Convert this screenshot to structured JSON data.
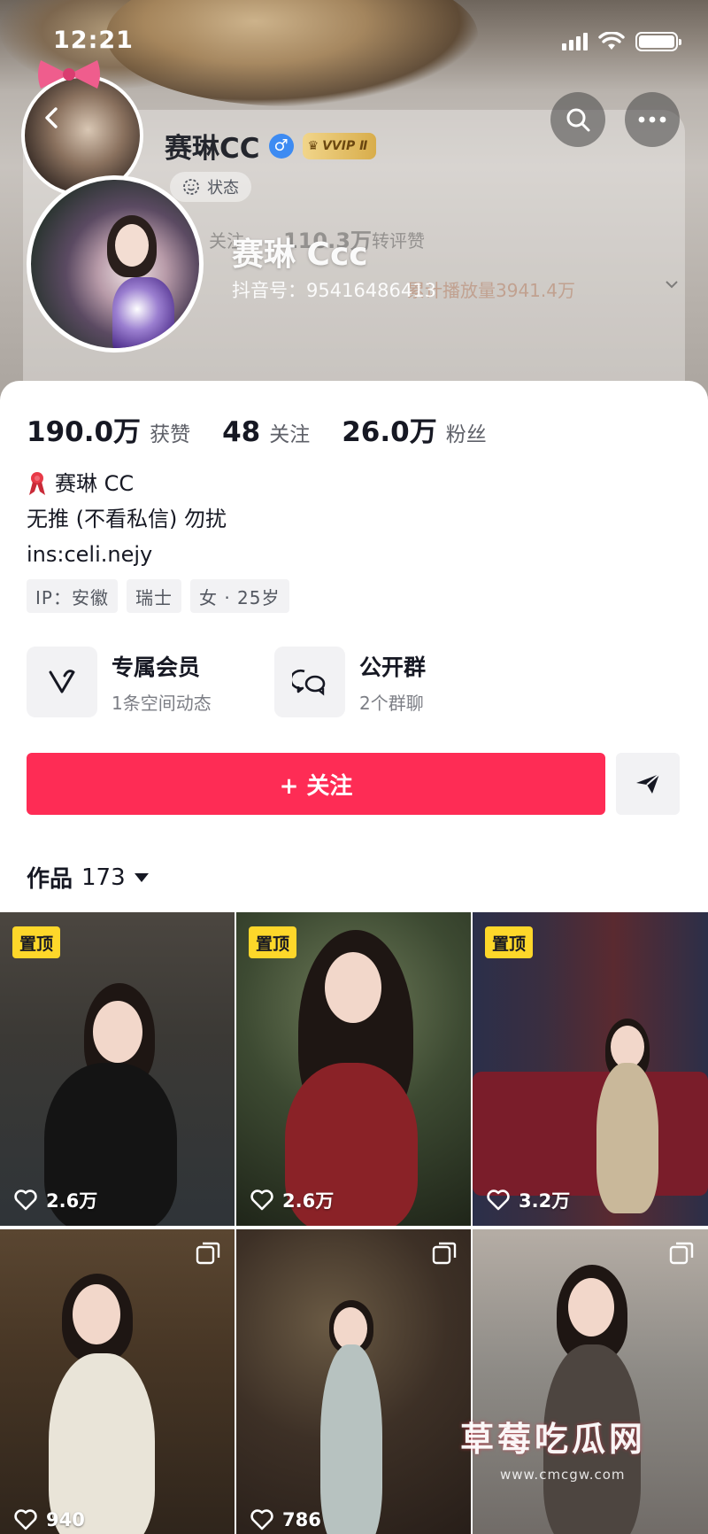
{
  "status_bar": {
    "time": "12:21"
  },
  "header": {
    "nickname": "赛琳CC",
    "vip_label": "VVIP Ⅱ",
    "status_chip": "状态",
    "big_name": "赛琳 Ccc",
    "douyin_id": "抖音号：95416486413",
    "ghost_following": "关注",
    "ghost_count": "110.3万",
    "ghost_interactions": "转评赞",
    "ghost_plays": "累计播放量3941.4万"
  },
  "stats": {
    "likes_value": "190.0万",
    "likes_label": "获赞",
    "following_value": "48",
    "following_label": "关注",
    "followers_value": "26.0万",
    "followers_label": "粉丝"
  },
  "bio": {
    "line1": "赛琳 CC",
    "line2": "无推 (不看私信) 勿扰",
    "line3": "ins:celi.nejy"
  },
  "tags": [
    "IP：安徽",
    "瑞士",
    "女 · 25岁"
  ],
  "features": [
    {
      "title": "专属会员",
      "subtitle": "1条空间动态",
      "icon": "heart-v-icon"
    },
    {
      "title": "公开群",
      "subtitle": "2个群聊",
      "icon": "chat-bubbles-icon"
    }
  ],
  "follow_button": {
    "label": "+ 关注"
  },
  "works": {
    "label": "作品",
    "count": "173"
  },
  "videos": [
    {
      "pinned_label": "置顶",
      "likes": "2.6万"
    },
    {
      "pinned_label": "置顶",
      "likes": "2.6万"
    },
    {
      "pinned_label": "置顶",
      "likes": "3.2万"
    },
    {
      "likes": "940"
    },
    {
      "likes": "786"
    },
    {
      "likes": ""
    }
  ],
  "watermark": {
    "text": "草莓吃瓜网",
    "url": "www.cmcgw.com"
  },
  "colors": {
    "accent": "#fe2c55",
    "pin": "#fdd72a",
    "verify": "#3d8bf2"
  }
}
